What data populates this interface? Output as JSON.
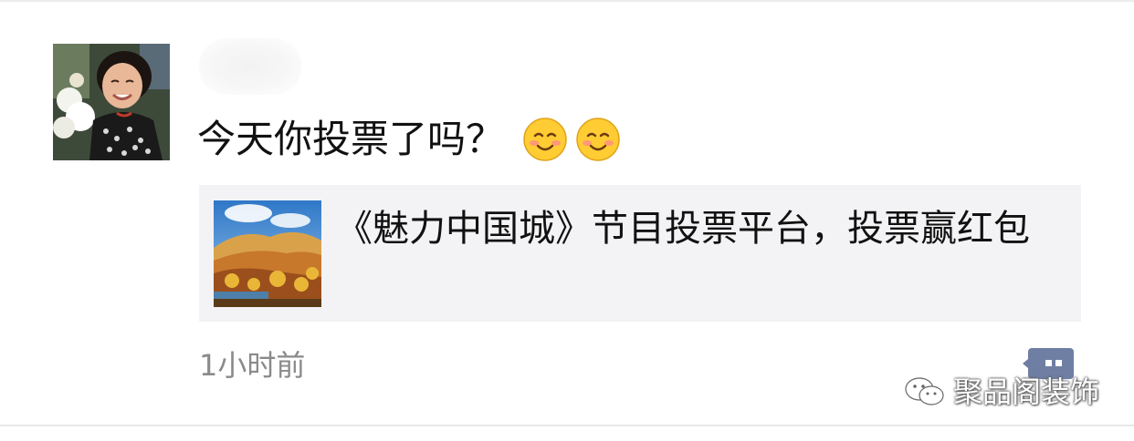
{
  "post": {
    "text": "今天你投票了吗？",
    "emojis": [
      "smiling-blush-emoji",
      "smiling-blush-emoji"
    ],
    "timestamp": "1小时前"
  },
  "link_card": {
    "title": "《魅力中国城》节目投票平台，投票赢红包"
  },
  "watermark": {
    "text": "聚品阁装饰"
  },
  "colors": {
    "card_bg": "#f3f3f5",
    "timestamp": "#8a8a8a",
    "comment_icon": "#6f7ea3"
  }
}
